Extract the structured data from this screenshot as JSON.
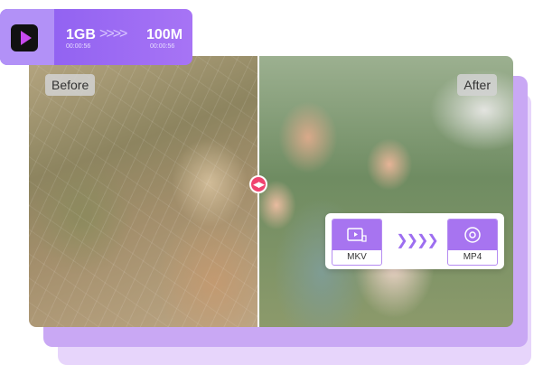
{
  "photo": {
    "before_label": "Before",
    "after_label": "After"
  },
  "compress_badge": {
    "from_size": "1GB",
    "from_time": "00:00:56",
    "arrows": ">>>>",
    "to_size": "100M",
    "to_time": "00:00:56"
  },
  "convert_card": {
    "source_format": "MKV",
    "arrows": "❯❯❯❯",
    "target_format": "MP4"
  },
  "colors": {
    "accent": "#9b6af3",
    "handle": "#f0436f"
  }
}
